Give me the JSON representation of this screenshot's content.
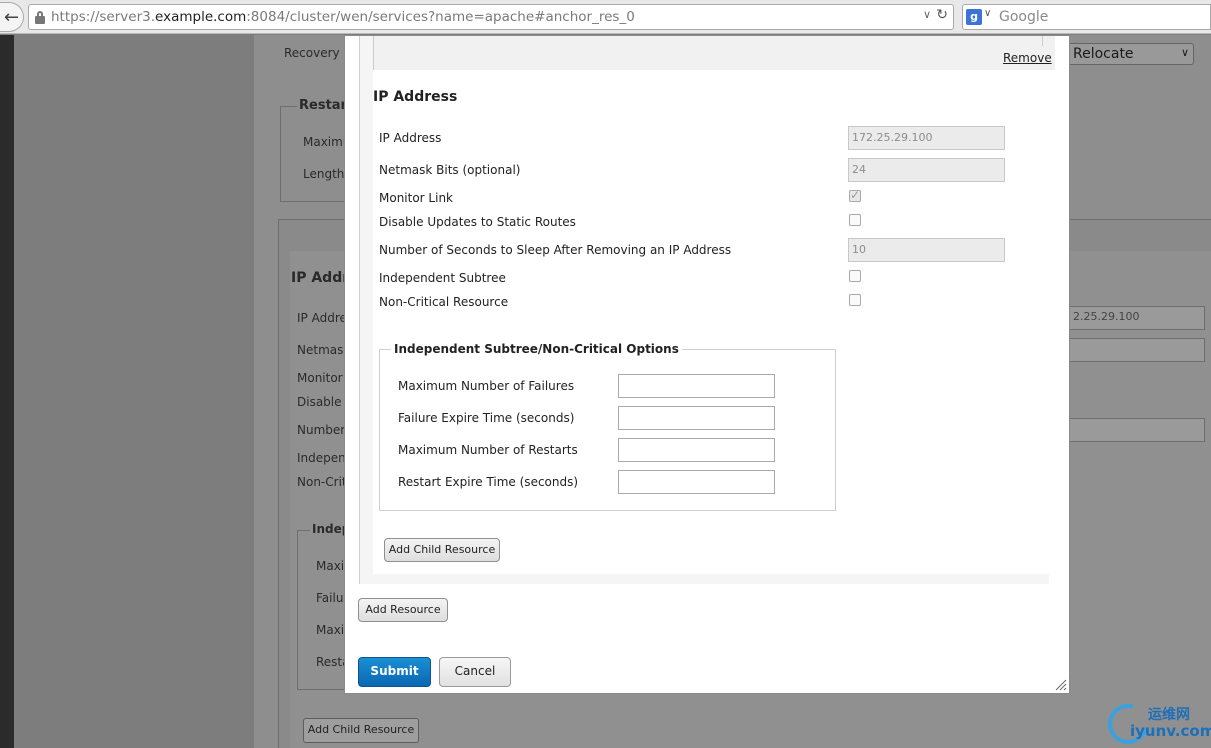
{
  "browser": {
    "url_prefix": "https://server3.",
    "url_host": "example.com",
    "url_suffix": ":8084/cluster/wen/services?name=apache#anchor_res_0",
    "search_placeholder": "Google",
    "search_engine_letter": "g"
  },
  "background": {
    "recovery_label": "Recovery P",
    "recovery_select_value": "Relocate",
    "restart_legend": "Restart",
    "maximum_label": "Maximu",
    "length_label": "Length",
    "ip_title": "IP Addr",
    "ip_label": "IP Addre",
    "ip_value": "2.25.29.100",
    "netmask_label": "Netmask",
    "monitor_label": "Monitor l",
    "disable_label": "Disable",
    "number_label": "Number",
    "independent_label": "Indepen",
    "noncrit_label": "Non-Crit",
    "opt_legend": "Indep",
    "opt_max_label": "Maxi",
    "opt_fail_label": "Failu",
    "opt_maxr_label": "Maxi",
    "opt_rest_label": "Resta",
    "add_child_label": "Add Child Resource"
  },
  "modal": {
    "remove_label": "Remove",
    "section_title": "IP Address",
    "fields": {
      "ip_address": {
        "label": "IP Address",
        "value": "172.25.29.100"
      },
      "netmask": {
        "label": "Netmask Bits (optional)",
        "value": "24"
      },
      "monitor_link": {
        "label": "Monitor Link",
        "checked": true
      },
      "disable_updates": {
        "label": "Disable Updates to Static Routes",
        "checked": false
      },
      "sleep_seconds": {
        "label": "Number of Seconds to Sleep After Removing an IP Address",
        "value": "10"
      },
      "independent_subtree": {
        "label": "Independent Subtree",
        "checked": false
      },
      "non_critical": {
        "label": "Non-Critical Resource",
        "checked": false
      }
    },
    "options": {
      "legend": "Independent Subtree/Non-Critical Options",
      "max_failures": {
        "label": "Maximum Number of Failures",
        "value": ""
      },
      "failure_expire": {
        "label": "Failure Expire Time (seconds)",
        "value": ""
      },
      "max_restarts": {
        "label": "Maximum Number of Restarts",
        "value": ""
      },
      "restart_expire": {
        "label": "Restart Expire Time (seconds)",
        "value": ""
      }
    },
    "add_child_resource_label": "Add Child Resource",
    "add_resource_label": "Add Resource",
    "submit_label": "Submit",
    "cancel_label": "Cancel"
  },
  "watermark": {
    "cn": "运维网",
    "en": "iyunv.com"
  }
}
